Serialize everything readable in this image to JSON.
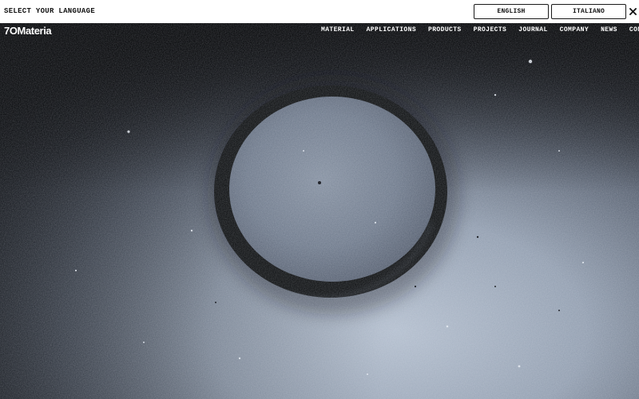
{
  "language_bar": {
    "prompt": "SELECT YOUR LANGUAGE",
    "options": [
      "ENGLISH",
      "ITALIANO"
    ],
    "close_symbol": "✕"
  },
  "header": {
    "logo": "7OMateria",
    "nav": [
      "MATERIAL",
      "APPLICATIONS",
      "PRODUCTS",
      "PROJECTS",
      "JOURNAL",
      "COMPANY",
      "NEWS",
      "CONTACTS"
    ]
  },
  "hero": {
    "image_description_icon": "concrete-circle-texture",
    "colors": {
      "surface_light": "#b5c0cf",
      "surface_mid": "#7e8a9c",
      "surface_dark": "#1b1e24",
      "groove": "#141618"
    }
  }
}
